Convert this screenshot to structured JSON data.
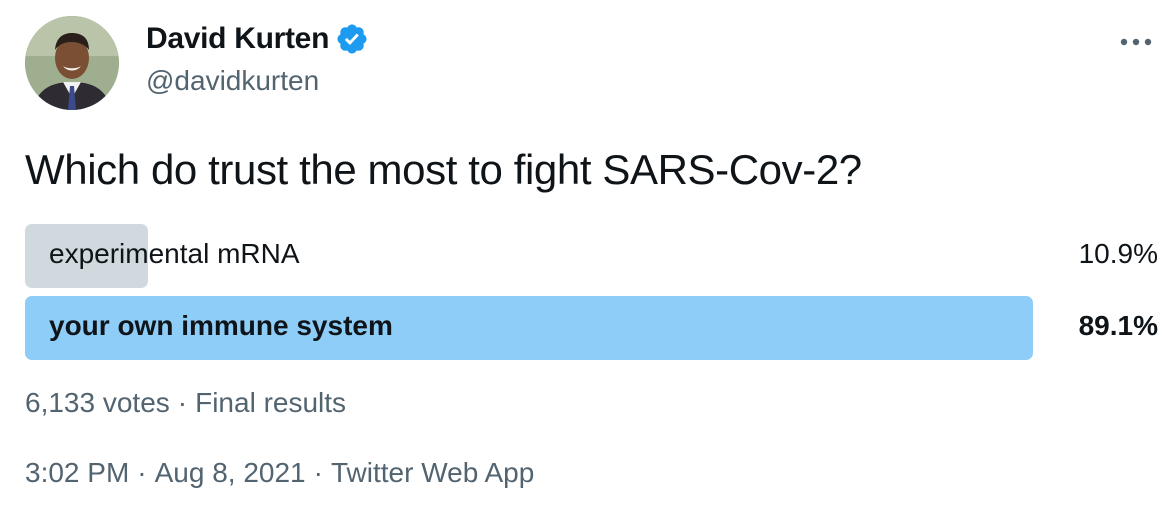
{
  "author": {
    "display_name": "David Kurten",
    "handle": "@davidkurten",
    "verified_icon": "verified-badge-icon",
    "avatar_icon": "avatar",
    "more_icon": "more-options-icon"
  },
  "tweet": {
    "question": "Which do trust the most to fight SARS-Cov-2?"
  },
  "poll": {
    "options": [
      {
        "label": "experimental mRNA",
        "percent_text": "10.9%",
        "share": 0.109,
        "winner": false
      },
      {
        "label": "your own immune system",
        "percent_text": "89.1%",
        "share": 0.891,
        "winner": true
      }
    ],
    "votes": "6,133 votes",
    "separator": "·",
    "status": "Final results"
  },
  "footer": {
    "time": "3:02 PM",
    "date": "Aug 8, 2021",
    "client": "Twitter Web App",
    "separator": "·"
  },
  "colors": {
    "text": "#0f1419",
    "secondary": "#536471",
    "bar_loser": "#cfd9de",
    "bar_winner": "#8ecdf8",
    "verified": "#1d9bf0"
  }
}
